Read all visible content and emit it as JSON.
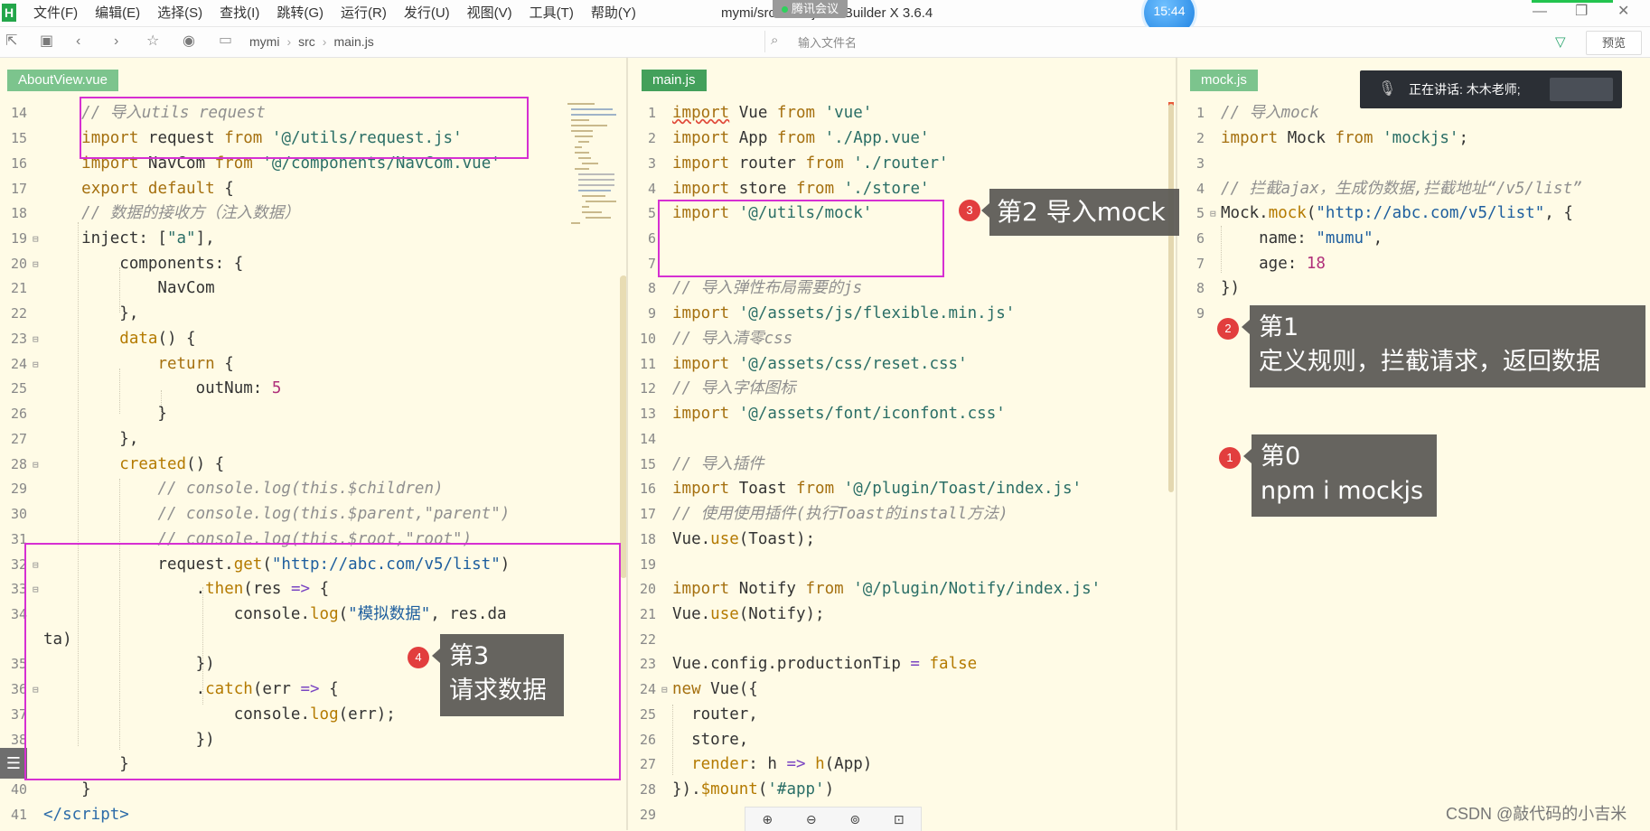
{
  "menubar": {
    "logo": "H",
    "items": [
      "文件(F)",
      "编辑(E)",
      "选择(S)",
      "查找(I)",
      "跳转(G)",
      "运行(R)",
      "发行(U)",
      "视图(V)",
      "工具(T)",
      "帮助(Y)"
    ],
    "window_title": "mymi/src/main.js - HBuilder X 3.6.4",
    "meeting_badge": "腾讯会议",
    "clock": "15:44"
  },
  "toolbar": {
    "breadcrumb": [
      "mymi",
      "src",
      "main.js"
    ],
    "file_search_placeholder": "输入文件名",
    "preview_label": "预览"
  },
  "panes": {
    "left_tab": "AboutView.vue",
    "middle_tab": "main.js",
    "right_tab": "mock.js"
  },
  "speaking": {
    "label": "正在讲话: 木木老师;"
  },
  "annotations": {
    "step0": {
      "number": "1",
      "text": "第0\nnpm i mockjs"
    },
    "step1": {
      "number": "2",
      "text": "第1\n定义规则，拦截请求，返回数据"
    },
    "step2": {
      "number": "3",
      "text": "第2 导入mock"
    },
    "step3": {
      "number": "4",
      "text": "第3\n请求数据"
    }
  },
  "watermark": "CSDN @敲代码的小吉米",
  "colors": {
    "editor_bg": "#fffbe6",
    "tab_active": "#43a05b",
    "highlight_box": "#d62fd2",
    "annotation_bg": "#5a5854",
    "step_dot": "#e23e3e",
    "comment": "#8f8f8f",
    "string": "#2a6e66",
    "keyword": "#a5700f",
    "number": "#b0307a"
  }
}
